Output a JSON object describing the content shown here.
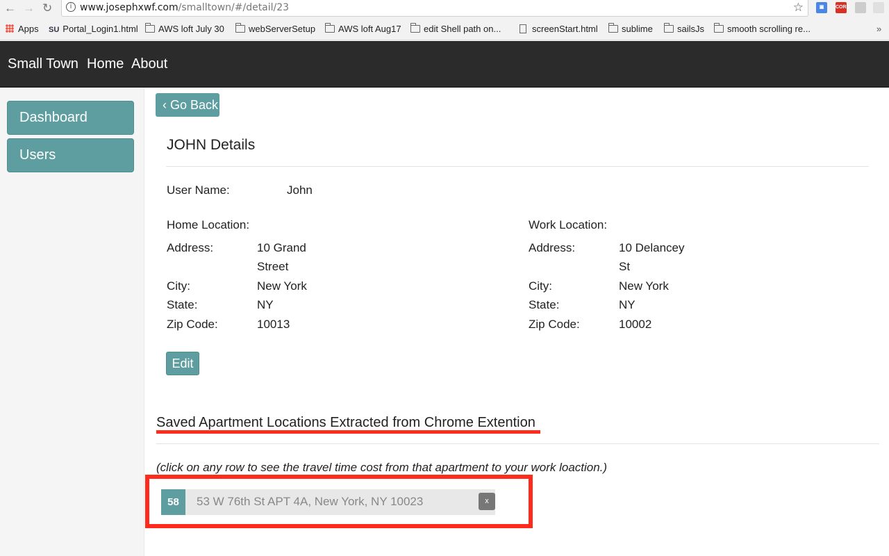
{
  "browser": {
    "url_host": "www.josephxwf.com",
    "url_path": "/smalltown/#/detail/23",
    "bookmarks": [
      "Apps",
      "Portal_Login1.html",
      "AWS loft July 30",
      "webServerSetup",
      "AWS loft Aug17",
      "edit Shell path on...",
      "screenStart.html",
      "sublime",
      "sailsJs",
      "smooth scrolling re..."
    ],
    "ext_cors": "CORS"
  },
  "navbar": {
    "brand": "Small Town",
    "links": [
      "Home",
      "About"
    ]
  },
  "sidebar": {
    "items": [
      "Dashboard",
      "Users"
    ]
  },
  "main": {
    "go_back": "‹ Go Back",
    "title": "JOHN Details",
    "user_name_label": "User Name:",
    "user_name_value": "John",
    "home": {
      "heading": "Home Location:",
      "address_label": "Address:",
      "address_line1": "10 Grand",
      "address_line2": "Street",
      "city_label": "City:",
      "city": "New York",
      "state_label": "State:",
      "state": "NY",
      "zip_label": "Zip Code:",
      "zip": "10013"
    },
    "work": {
      "heading": "Work Location:",
      "address_label": "Address:",
      "address_line1": "10 Delancey",
      "address_line2": "St",
      "city_label": "City:",
      "city": "New York",
      "state_label": "State:",
      "state": "NY",
      "zip_label": "Zip Code:",
      "zip": "10002"
    },
    "edit_label": "Edit",
    "saved_title": "Saved Apartment Locations Extracted from Chrome Extention",
    "hint": "(click on any row to see the travel time cost from that apartment to your work loaction.)",
    "apartments": [
      {
        "id": "58",
        "address": "53 W 76th St APT 4A, New York, NY 10023",
        "delete_label": "x"
      }
    ]
  },
  "colors": {
    "accent": "#5f9ea0",
    "navbar": "#2b2b2b",
    "annotation_red": "#ff2b1c"
  }
}
